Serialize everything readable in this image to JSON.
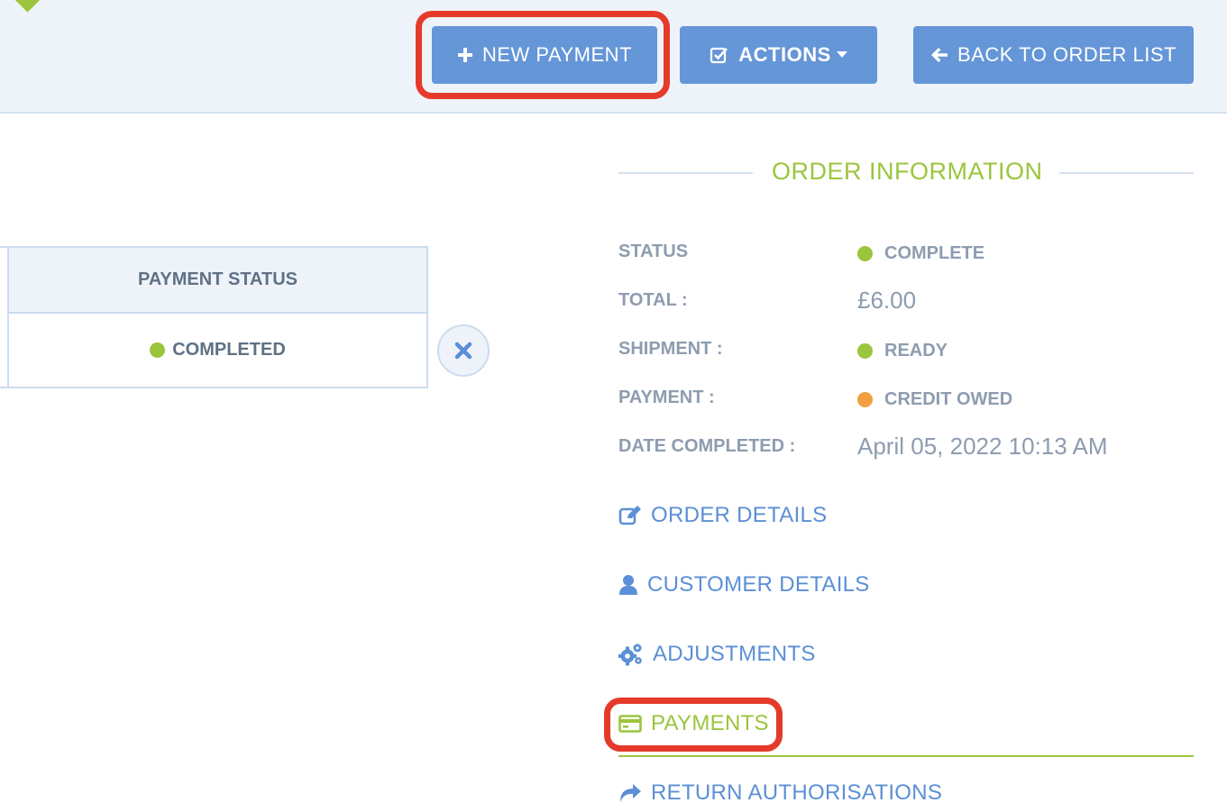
{
  "colors": {
    "accent_blue": "#6496d8",
    "link_blue": "#5b8fd6",
    "green": "#9bc53d",
    "orange": "#f0a040",
    "highlight_red": "#e53a2a",
    "label_grey": "#8e9caf"
  },
  "toolbar": {
    "new_payment_label": "NEW PAYMENT",
    "actions_label": "ACTIONS",
    "back_label": "BACK TO ORDER LIST"
  },
  "payments_table": {
    "header": "PAYMENT STATUS",
    "rows": [
      {
        "status": "COMPLETED",
        "status_color": "green"
      }
    ]
  },
  "order_information": {
    "title": "ORDER INFORMATION",
    "fields": {
      "status": {
        "label": "STATUS",
        "value": "COMPLETE",
        "dot": "green"
      },
      "total": {
        "label": "TOTAL :",
        "value": "£6.00"
      },
      "shipment": {
        "label": "SHIPMENT :",
        "value": "READY",
        "dot": "green"
      },
      "payment": {
        "label": "PAYMENT :",
        "value": "CREDIT OWED",
        "dot": "orange"
      },
      "date_completed": {
        "label": "DATE COMPLETED :",
        "value": "April 05, 2022 10:13 AM"
      }
    }
  },
  "nav": {
    "order_details": {
      "label": "ORDER DETAILS",
      "icon": "edit-icon"
    },
    "customer_details": {
      "label": "CUSTOMER DETAILS",
      "icon": "user-icon"
    },
    "adjustments": {
      "label": "ADJUSTMENTS",
      "icon": "gears-icon"
    },
    "payments": {
      "label": "PAYMENTS",
      "icon": "credit-card-icon",
      "active": true
    },
    "return_authorisations": {
      "label": "RETURN AUTHORISATIONS",
      "icon": "share-icon"
    }
  }
}
